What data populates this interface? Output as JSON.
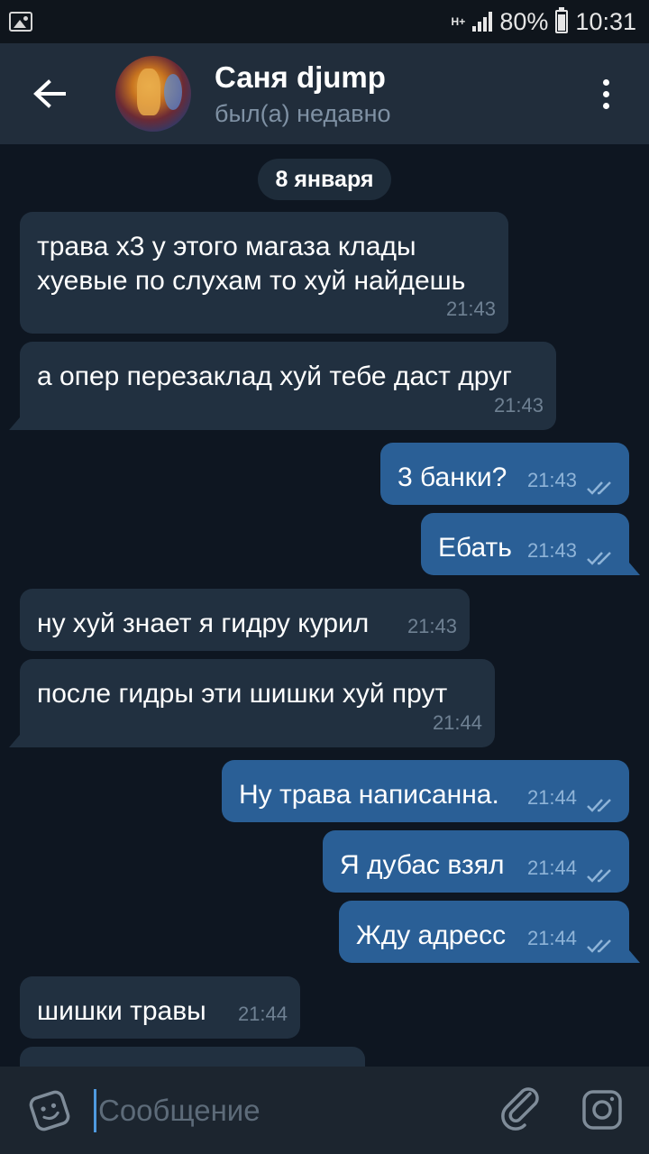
{
  "status_bar": {
    "network": "H+",
    "battery_percent": "80%",
    "time": "10:31"
  },
  "header": {
    "contact_name": "Саня djump",
    "contact_status": "был(а) недавно"
  },
  "date_separator": "8 января",
  "messages": [
    {
      "direction": "in",
      "lines": [
        "трава х3 у этого магаза клады",
        "хуевые по слухам то хуй найдешь"
      ],
      "time": "21:43"
    },
    {
      "direction": "in",
      "lines": [
        "а опер перезаклад хуй тебе даст друг"
      ],
      "time": "21:43"
    },
    {
      "direction": "out",
      "lines": [
        "3 банки?"
      ],
      "time": "21:43",
      "read": true
    },
    {
      "direction": "out",
      "lines": [
        "Ебать"
      ],
      "time": "21:43",
      "read": true
    },
    {
      "direction": "in",
      "lines": [
        "ну хуй знает я гидру курил"
      ],
      "time": "21:43"
    },
    {
      "direction": "in",
      "lines": [
        "после гидры эти шишки хуй прут"
      ],
      "time": "21:44"
    },
    {
      "direction": "out",
      "lines": [
        "Ну трава написанна."
      ],
      "time": "21:44",
      "read": true
    },
    {
      "direction": "out",
      "lines": [
        "Я дубас взял"
      ],
      "time": "21:44",
      "read": true
    },
    {
      "direction": "out",
      "lines": [
        "Жду адресс"
      ],
      "time": "21:44",
      "read": true
    },
    {
      "direction": "in",
      "lines": [
        "шишки травы"
      ],
      "time": "21:44"
    }
  ],
  "input": {
    "placeholder": "Сообщение"
  },
  "icons": {
    "back": "arrow-left-icon",
    "menu": "more-vertical-icon",
    "sticker": "sticker-icon",
    "attach": "paperclip-icon",
    "camera": "camera-icon"
  },
  "colors": {
    "background": "#0e1621",
    "header": "#212d3b",
    "incoming_bubble": "#213040",
    "outgoing_bubble": "#2a5f96",
    "accent": "#4f9ae0"
  }
}
